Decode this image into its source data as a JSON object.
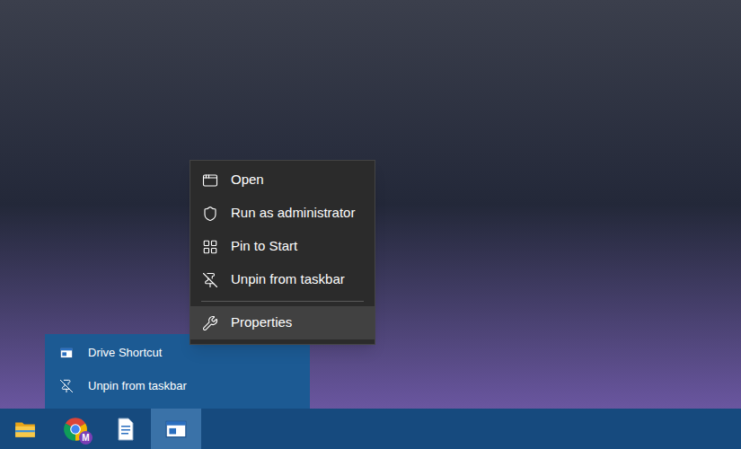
{
  "context_menu": {
    "items": [
      {
        "label": "Open",
        "kind": "open",
        "highlighted": false,
        "separator_before": false
      },
      {
        "label": "Run as administrator",
        "kind": "admin",
        "highlighted": false,
        "separator_before": false
      },
      {
        "label": "Pin to Start",
        "kind": "pin",
        "highlighted": false,
        "separator_before": false
      },
      {
        "label": "Unpin from taskbar",
        "kind": "unpin",
        "highlighted": false,
        "separator_before": false
      },
      {
        "label": "Properties",
        "kind": "properties",
        "highlighted": true,
        "separator_before": true
      }
    ]
  },
  "jump_list": {
    "items": [
      {
        "label": "Drive Shortcut",
        "kind": "app"
      },
      {
        "label": "Unpin from taskbar",
        "kind": "unpin"
      }
    ]
  },
  "taskbar": {
    "items": [
      {
        "kind": "explorer",
        "selected": false,
        "badge": ""
      },
      {
        "kind": "chrome",
        "selected": false,
        "badge": "M"
      },
      {
        "kind": "document",
        "selected": false,
        "badge": ""
      },
      {
        "kind": "app",
        "selected": true,
        "badge": ""
      }
    ]
  }
}
